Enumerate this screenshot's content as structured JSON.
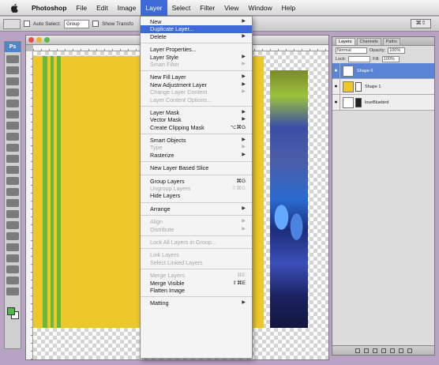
{
  "menubar": {
    "app": "Photoshop",
    "items": [
      "File",
      "Edit",
      "Image",
      "Layer",
      "Select",
      "Filter",
      "View",
      "Window",
      "Help"
    ],
    "active": "Layer"
  },
  "optionsbar": {
    "auto_select": "Auto Select:",
    "group": "Group",
    "show_transform": "Show Transfo",
    "right_button": "⌘⇧"
  },
  "layer_menu": {
    "items": [
      {
        "label": "New",
        "arrow": true
      },
      {
        "label": "Duplicate Layer...",
        "highlighted": true
      },
      {
        "label": "Delete",
        "arrow": true
      },
      {
        "sep": true
      },
      {
        "label": "Layer Properties..."
      },
      {
        "label": "Layer Style",
        "arrow": true
      },
      {
        "label": "Smart Filter",
        "disabled": true,
        "arrow": true
      },
      {
        "sep": true
      },
      {
        "label": "New Fill Layer",
        "arrow": true
      },
      {
        "label": "New Adjustment Layer",
        "arrow": true
      },
      {
        "label": "Change Layer Content",
        "disabled": true,
        "arrow": true
      },
      {
        "label": "Layer Content Options...",
        "disabled": true
      },
      {
        "sep": true
      },
      {
        "label": "Layer Mask",
        "arrow": true
      },
      {
        "label": "Vector Mask",
        "arrow": true
      },
      {
        "label": "Create Clipping Mask",
        "shortcut": "⌥⌘G"
      },
      {
        "sep": true
      },
      {
        "label": "Smart Objects",
        "arrow": true
      },
      {
        "label": "Type",
        "disabled": true,
        "arrow": true
      },
      {
        "label": "Rasterize",
        "arrow": true
      },
      {
        "sep": true
      },
      {
        "label": "New Layer Based Slice"
      },
      {
        "sep": true
      },
      {
        "label": "Group Layers",
        "shortcut": "⌘G"
      },
      {
        "label": "Ungroup Layers",
        "disabled": true,
        "shortcut": "⇧⌘G"
      },
      {
        "label": "Hide Layers"
      },
      {
        "sep": true
      },
      {
        "label": "Arrange",
        "arrow": true
      },
      {
        "sep": true
      },
      {
        "label": "Align",
        "disabled": true,
        "arrow": true
      },
      {
        "label": "Distribute",
        "disabled": true,
        "arrow": true
      },
      {
        "sep": true
      },
      {
        "label": "Lock All Layers in Group...",
        "disabled": true
      },
      {
        "sep": true
      },
      {
        "label": "Link Layers",
        "disabled": true
      },
      {
        "label": "Select Linked Layers",
        "disabled": true
      },
      {
        "sep": true
      },
      {
        "label": "Merge Layers",
        "disabled": true,
        "shortcut": "⌘E"
      },
      {
        "label": "Merge Visible",
        "shortcut": "⇧⌘E"
      },
      {
        "label": "Flatten Image"
      },
      {
        "sep": true
      },
      {
        "label": "Matting",
        "arrow": true
      }
    ]
  },
  "layers_panel": {
    "tabs": [
      "Layers",
      "Channels",
      "Paths"
    ],
    "blend_mode": "Normal",
    "opacity_label": "Opacity:",
    "opacity": "100%",
    "lock_label": "Lock:",
    "fill_label": "Fill:",
    "fill": "100%",
    "layers": [
      {
        "name": "Shape 6",
        "selected": true,
        "thumb": "white"
      },
      {
        "name": "Shape 1",
        "selected": false,
        "thumb": "yellow",
        "mask": true
      },
      {
        "name": "loveBluebird",
        "selected": false,
        "thumb": "white",
        "mask_dark": true
      }
    ]
  },
  "colors": {
    "canvas_yellow": "#ecc82a",
    "stripe_green": "#6ab83a",
    "menu_highlight": "#3d6ad6",
    "foreground_swatch": "#4dbb4a"
  }
}
